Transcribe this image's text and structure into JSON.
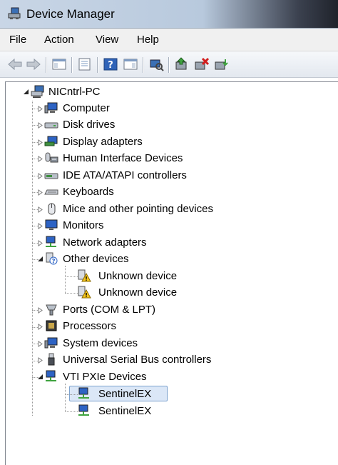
{
  "window": {
    "title": "Device Manager"
  },
  "menu": [
    "File",
    "Action",
    "View",
    "Help"
  ],
  "tree": {
    "root": "NICntrl-PC",
    "items": [
      {
        "label": "Computer",
        "icon": "computer-icon"
      },
      {
        "label": "Disk drives",
        "icon": "disk-drive-icon"
      },
      {
        "label": "Display adapters",
        "icon": "display-adapter-icon"
      },
      {
        "label": "Human Interface Devices",
        "icon": "hid-icon"
      },
      {
        "label": "IDE ATA/ATAPI controllers",
        "icon": "ide-controller-icon"
      },
      {
        "label": "Keyboards",
        "icon": "keyboard-icon"
      },
      {
        "label": "Mice and other pointing devices",
        "icon": "mouse-icon"
      },
      {
        "label": "Monitors",
        "icon": "monitor-icon"
      },
      {
        "label": "Network adapters",
        "icon": "network-adapter-icon"
      },
      {
        "label": "Other devices",
        "icon": "other-devices-icon"
      },
      {
        "label": "Unknown device",
        "icon": "unknown-device-warning-icon"
      },
      {
        "label": "Unknown device",
        "icon": "unknown-device-warning-icon"
      },
      {
        "label": "Ports (COM & LPT)",
        "icon": "port-icon"
      },
      {
        "label": "Processors",
        "icon": "processor-icon"
      },
      {
        "label": "System devices",
        "icon": "system-device-icon"
      },
      {
        "label": "Universal Serial Bus controllers",
        "icon": "usb-icon"
      },
      {
        "label": "VTI PXIe Devices",
        "icon": "pxie-device-icon"
      },
      {
        "label": "SentinelEX",
        "icon": "pxie-device-icon"
      },
      {
        "label": "SentinelEX",
        "icon": "pxie-device-icon"
      }
    ]
  },
  "colors": {
    "selection": "#dbe7f7",
    "selection_border": "#7da2ce"
  }
}
